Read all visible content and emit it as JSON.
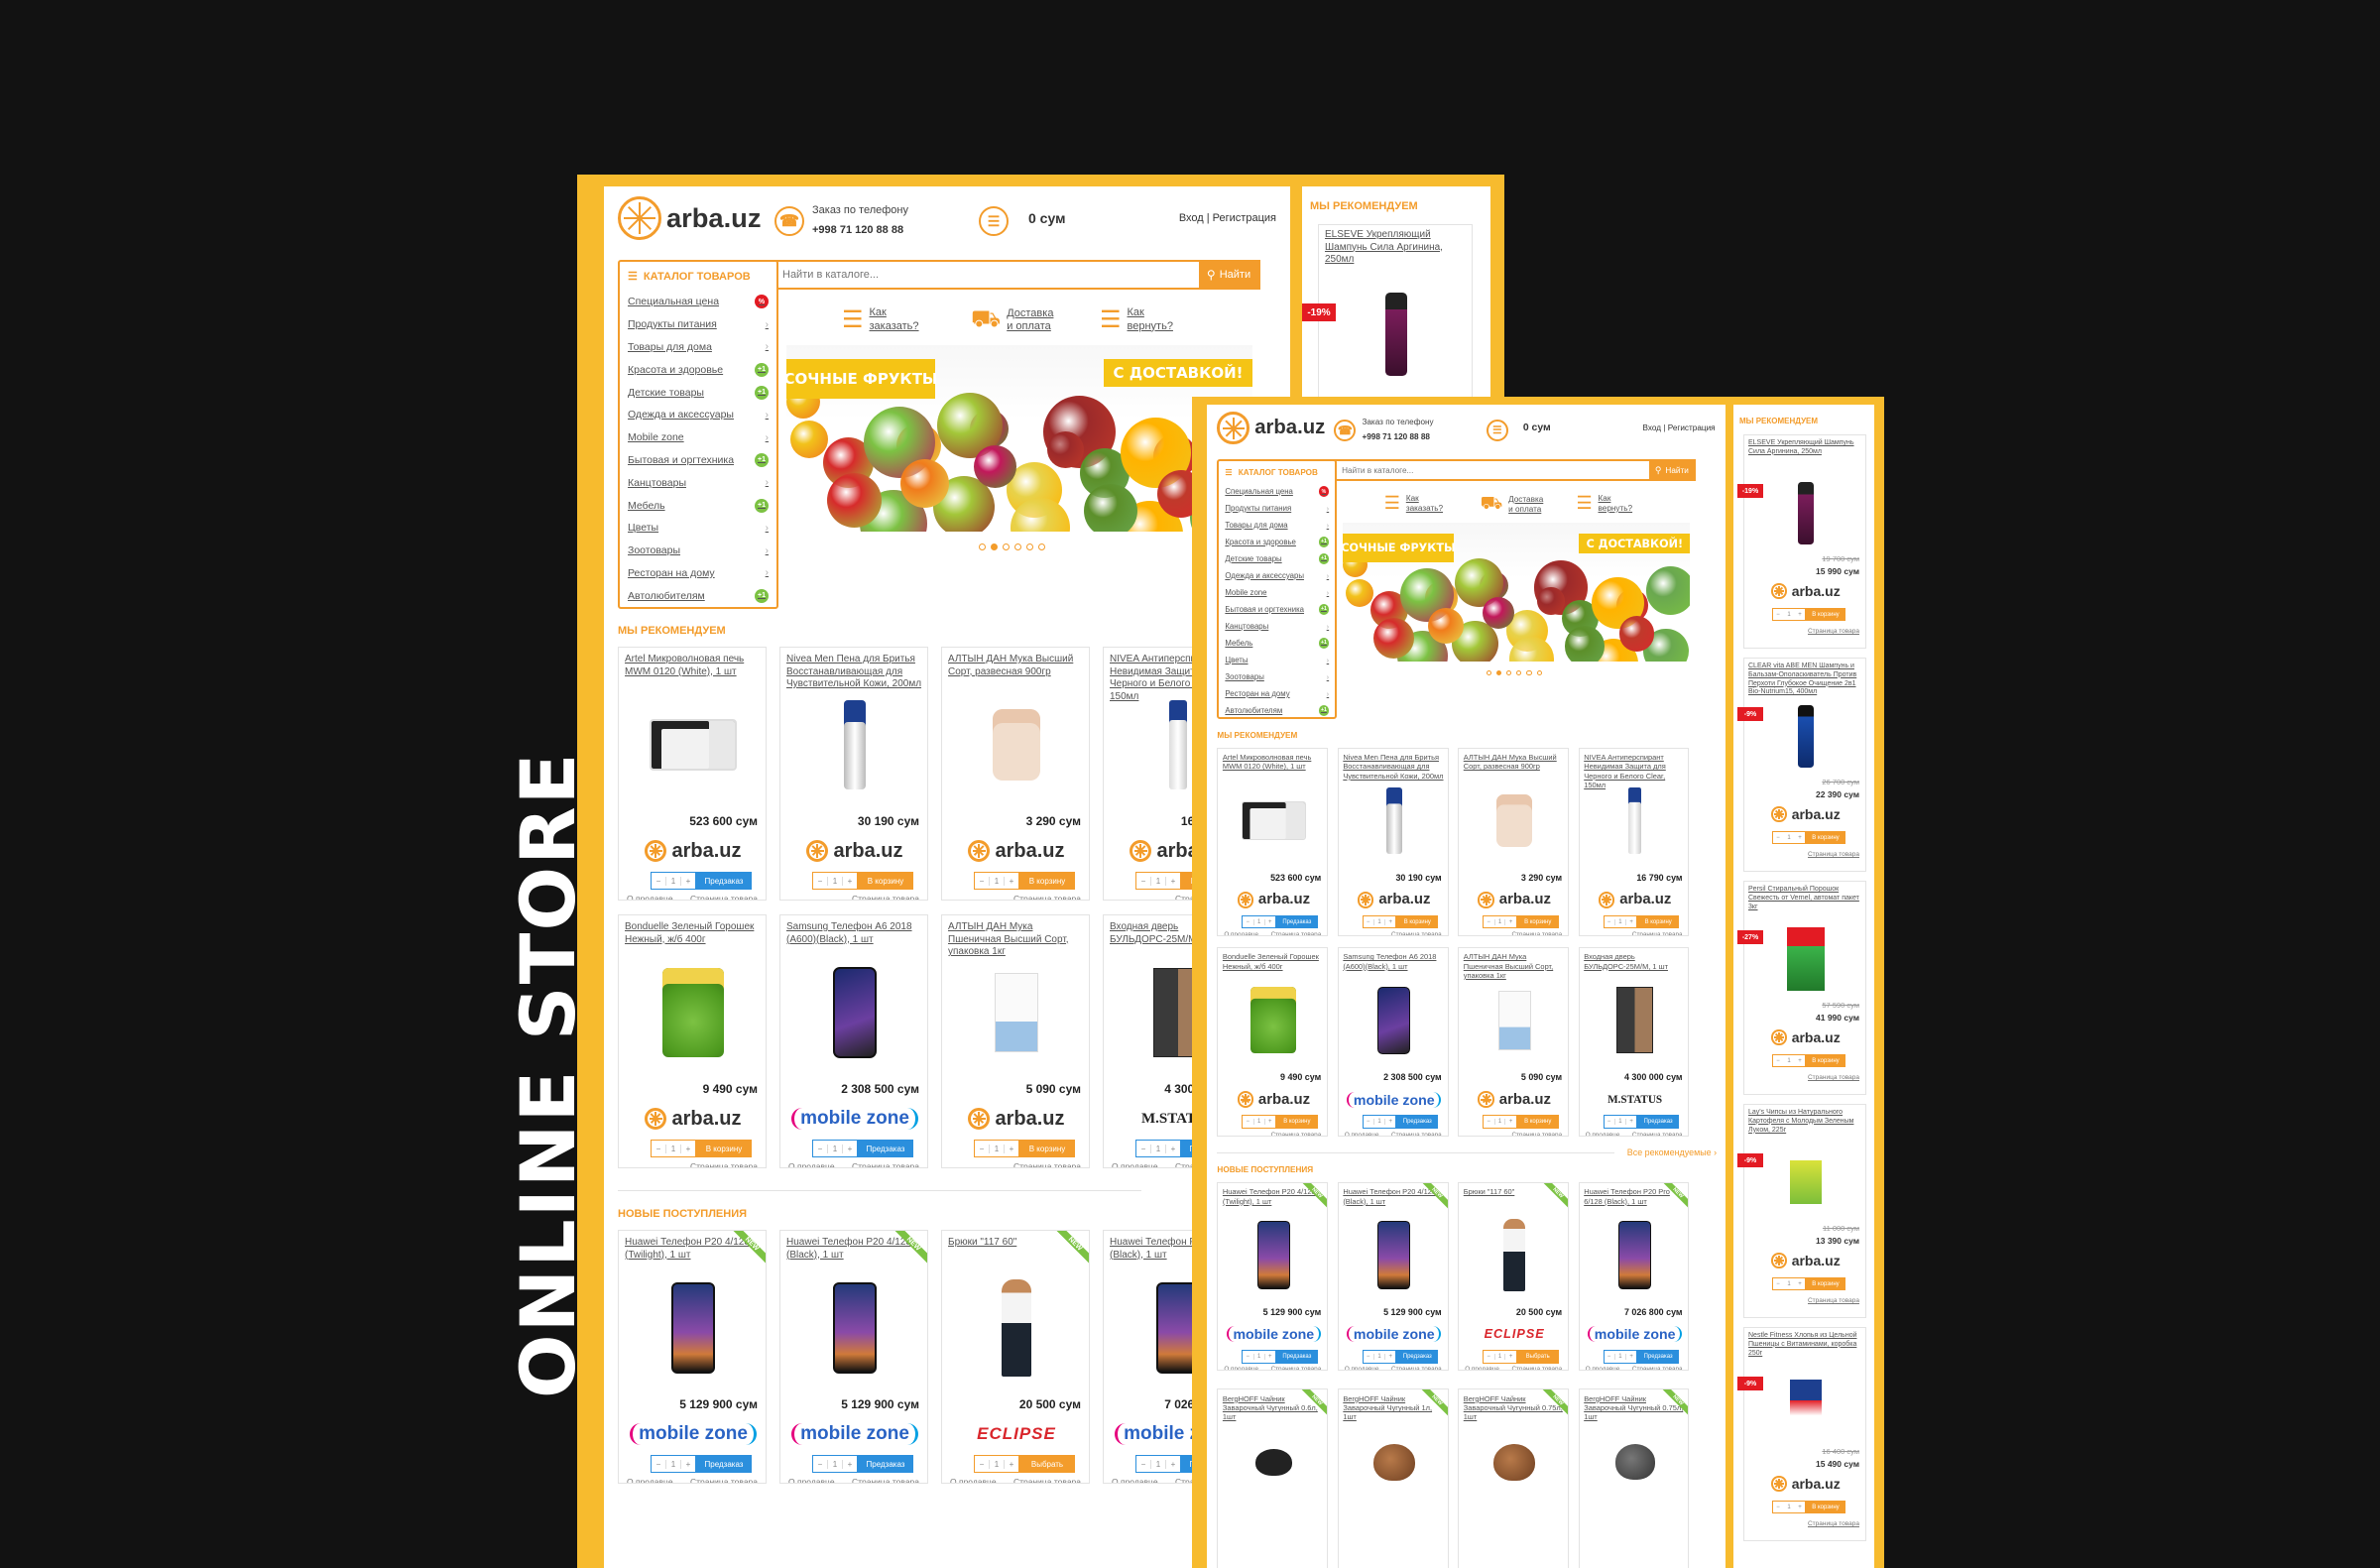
{
  "side_title": "ONLINE STORE",
  "brand_name": "arba.uz",
  "header": {
    "phone_label": "Заказ по телефону",
    "phone_number": "+998 71 120 88 88",
    "cart_total": "0 сум",
    "auth": "Вход | Регистрация",
    "auth_small": "Вход | Регистрация"
  },
  "search": {
    "placeholder": "Найти в каталоге...",
    "button": "Найти"
  },
  "catalog": {
    "title": "КАТАЛОГ ТОВАРОВ",
    "items": [
      {
        "label": "Специальная цена",
        "badge": "%",
        "badge_color": "#e31b23"
      },
      {
        "label": "Продукты питания",
        "badge": ""
      },
      {
        "label": "Товары для дома",
        "badge": ""
      },
      {
        "label": "Красота и здоровье",
        "badge": "+1",
        "badge_color": "#7cc243"
      },
      {
        "label": "Детские товары",
        "badge": "+1",
        "badge_color": "#7cc243"
      },
      {
        "label": "Одежда и аксессуары",
        "badge": ""
      },
      {
        "label": "Mobile zone",
        "badge": ""
      },
      {
        "label": "Бытовая и оргтехника",
        "badge": "+1",
        "badge_color": "#7cc243"
      },
      {
        "label": "Канцтовары",
        "badge": ""
      },
      {
        "label": "Мебель",
        "badge": "+1",
        "badge_color": "#7cc243"
      },
      {
        "label": "Цветы",
        "badge": ""
      },
      {
        "label": "Зоотовары",
        "badge": ""
      },
      {
        "label": "Ресторан на дому",
        "badge": ""
      },
      {
        "label": "Автолюбителям",
        "badge": "+1",
        "badge_color": "#7cc243"
      }
    ]
  },
  "services": [
    {
      "line1": "Как",
      "line2": "заказать?",
      "icon": "cart-icon"
    },
    {
      "line1": "Доставка",
      "line2": "и оплата",
      "icon": "truck-icon"
    },
    {
      "line1": "Как",
      "line2": "вернуть?",
      "icon": "return-cart-icon"
    }
  ],
  "banner": {
    "left": "СОЧНЫЕ ФРУКТЫ",
    "right": "С ДОСТАВКОЙ!",
    "slides": 6,
    "active": 1
  },
  "sections": {
    "recommend": "МЫ РЕКОМЕНДУЕМ",
    "new": "НОВЫЕ ПОСТУПЛЕНИЯ",
    "all_rec": "Все рекомендуемые",
    "all_rec_cut": "Все рек"
  },
  "labels": {
    "about_seller": "О продавце",
    "product_page": "Страница товара",
    "preorder": "Предзаказ",
    "to_cart": "В корзину",
    "choose": "Выбрать",
    "qty": "1"
  },
  "recommended": [
    {
      "title": "Artel Микроволновая печь MWM 0120 (White), 1 шт",
      "price": "523 600 сум",
      "brand": "arba.uz",
      "action": "Предзаказ",
      "img": "microwave"
    },
    {
      "title": "Nivea Men Пена для Бритья Восстанавливающая для Чувствительной Кожи, 200мл",
      "price": "30 190 сум",
      "brand": "arba.uz",
      "action": "В корзину",
      "img": "can"
    },
    {
      "title": "АЛТЫН ДАН Мука Высший Сорт, развесная 900гр",
      "price": "3 290 сум",
      "brand": "arba.uz",
      "action": "В корзину",
      "img": "flour"
    },
    {
      "title": "NIVEA Антиперспирант Невидимая Защита для Черного и Белого Clear, 150мл",
      "price": "16 790 сум",
      "brand": "arba.uz",
      "action": "В корзину",
      "img": "spray"
    },
    {
      "title": "Bonduelle Зеленый Горошек Нежный, ж/б 400г",
      "price": "9 490 сум",
      "brand": "arba.uz",
      "action": "В корзину",
      "img": "peas"
    },
    {
      "title": "Samsung Телефон A6 2018 (A600)(Black), 1 шт",
      "price": "2 308 500 сум",
      "brand": "mobile zone",
      "action": "Предзаказ",
      "img": "phone"
    },
    {
      "title": "АЛТЫН ДАН Мука Пшеничная Высший Сорт, упаковка 1кг",
      "price": "5 090 сум",
      "brand": "arba.uz",
      "action": "В корзину",
      "img": "flourbag"
    },
    {
      "title": "Входная дверь БУЛЬДОРС-25М/М, 1 шт",
      "price": "4 300 000 сум",
      "brand": "M.STATUS",
      "action": "Предзаказ",
      "img": "door"
    }
  ],
  "new_items": [
    {
      "title": "Huawei Телефон P20 4/128 (Twilight), 1 шт",
      "price": "5 129 900 сум",
      "brand": "mobile zone",
      "action": "Предзаказ",
      "img": "phone2"
    },
    {
      "title": "Huawei Телефон P20 4/128 (Black), 1 шт",
      "price": "5 129 900 сум",
      "brand": "mobile zone",
      "action": "Предзаказ",
      "img": "phone2"
    },
    {
      "title": "Брюки \"117 60\"",
      "price": "20 500 сум",
      "brand": "ECLIPSE",
      "action": "Выбрать",
      "img": "girl"
    },
    {
      "title": "Huawei Телефон P20 Pro 6/128 (Black), 1 шт",
      "price": "7 026 800 сум",
      "brand": "mobile zone",
      "action": "Предзаказ",
      "img": "phone2"
    },
    {
      "title": "BergHOFF Чайник Заварочный Чугунный 0.6л, 1шт",
      "price": "",
      "img": "teapot"
    },
    {
      "title": "BergHOFF Чайник Заварочный Чугунный 1л, 1шт",
      "price": "",
      "img": "teapot2"
    },
    {
      "title": "BergHOFF Чайник Заварочный Чугунный 0.75л, 1шт",
      "price": "",
      "img": "teapot2"
    },
    {
      "title": "BergHOFF Чайник Заварочный Чугунный 0.75л, 1шт",
      "price": "",
      "img": "teapot3"
    }
  ],
  "new_cut_titles": [
    "Huawei Телефон P20 4/128 (Twilight), 1 шт",
    "Huawei Телефон P20 4/128 (Black), 1 шт",
    "Брюки \"117 60\"",
    "Huawei Телефон P20 4/128 (Black), 1 шт"
  ],
  "sidebar": {
    "title": "МЫ РЕКОМЕНДУЕМ",
    "back_item": {
      "title": "ELSEVE Укрепляющий Шампунь Сила Аргинина, 250мл",
      "discount": "-19%",
      "old_price": "19 700 сум"
    },
    "items": [
      {
        "title": "ELSEVE Укрепляющий Шампунь Сила Аргинина, 250мл",
        "discount": "-19%",
        "old_price": "19 700 сум",
        "price": "15 990 сум",
        "img": "shampoo"
      },
      {
        "title": "CLEAR vita ABE MEN Шампунь и Бальзам-Ополаскиватель Против Перхоти Глубокое Очищение 2в1 Bio-Nutrium15, 400мл",
        "discount": "-9%",
        "old_price": "26 700 сум",
        "price": "22 390 сум",
        "img": "clear"
      },
      {
        "title": "Persil Стиральный Порошок Свежесть от Vernel, автомат пакет 3кг",
        "discount": "-27%",
        "old_price": "57 590 сум",
        "price": "41 990 сум",
        "img": "persil"
      },
      {
        "title": "Lay's Чипсы из Натурального Картофеля с Молодым Зеленым Луком, 225г",
        "discount": "-9%",
        "old_price": "11 000 сум",
        "price": "13 390 сум",
        "img": "chips"
      },
      {
        "title": "Nestle Fitness Хлопья из Цельной Пшеницы с Витаминами, коробка 250г",
        "discount": "-9%",
        "old_price": "16 400 сум",
        "price": "15 490 сум",
        "img": "cereal"
      }
    ]
  },
  "colors": {
    "accent": "#f39c2b",
    "frame": "#f7bb2e",
    "preorder_blue": "#2b8fdd",
    "sale_red": "#e31b23",
    "new_green": "#7cc243"
  }
}
